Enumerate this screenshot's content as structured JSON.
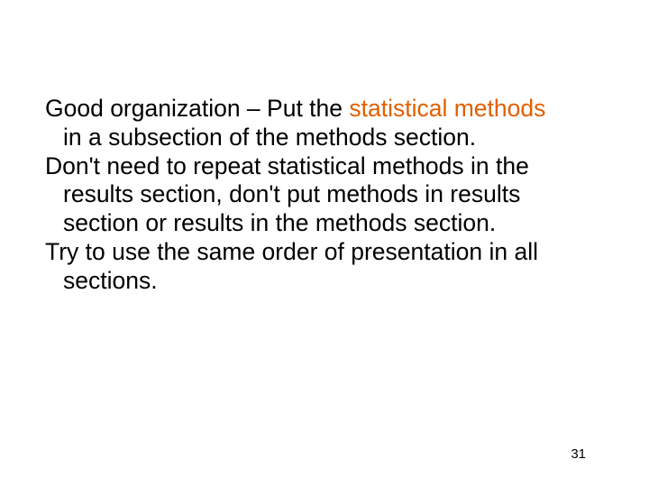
{
  "slide": {
    "para1": {
      "pre": "Good organization – Put the ",
      "highlight": "statistical methods",
      "post": " in a subsection of the methods section."
    },
    "para2": "Don't need to repeat statistical methods in the results section, don't put methods in results section or results in the methods section.",
    "para3": "Try to use the same order of presentation in all sections.",
    "page_number": "31"
  }
}
